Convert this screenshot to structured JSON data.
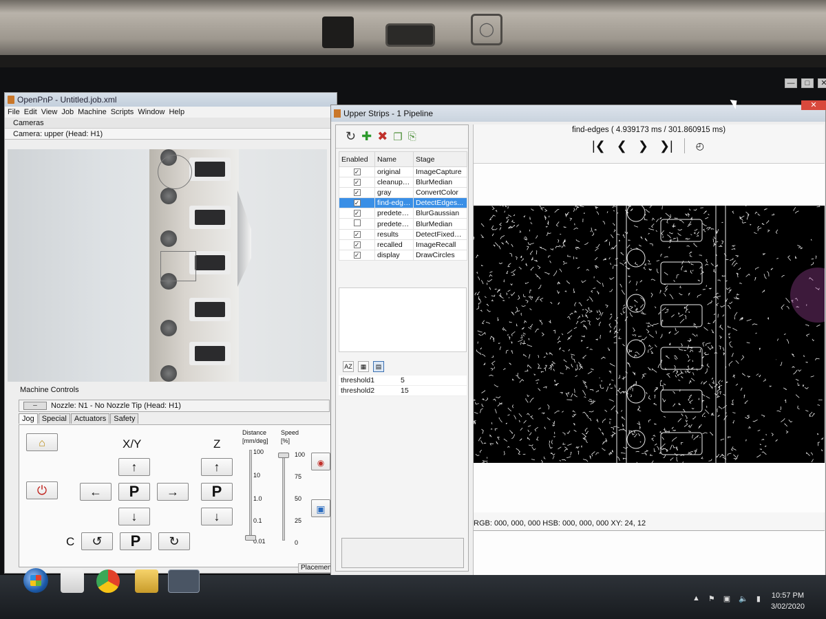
{
  "main_window": {
    "title": "OpenPnP - Untitled.job.xml",
    "menu": [
      "File",
      "Edit",
      "View",
      "Job",
      "Machine",
      "Scripts",
      "Window",
      "Help"
    ],
    "cameras_label": "Cameras",
    "camera_label": "Camera: upper (Head: H1)",
    "machine_controls_label": "Machine Controls",
    "nozzle_label": "Nozzle: N1 - No Nozzle Tip (Head: H1)",
    "tabs": [
      "Jog",
      "Special",
      "Actuators",
      "Safety"
    ],
    "jog": {
      "xy_label": "X/Y",
      "z_label": "Z",
      "c_label": "C",
      "park_label": "P",
      "distance_label": "Distance",
      "distance_unit": "[mm/deg]",
      "speed_label": "Speed",
      "speed_unit": "[%]",
      "distance_ticks": [
        "100",
        "10",
        "1.0",
        "0.1",
        "0.01"
      ],
      "speed_ticks": [
        "100",
        "75",
        "50",
        "25",
        "0"
      ],
      "speed_percent": 100,
      "distance_value": "0.01"
    },
    "status_tab": "Placements"
  },
  "pipeline_window": {
    "title": "Upper Strips - 1 Pipeline",
    "columns": [
      "Enabled",
      "Name",
      "Stage"
    ],
    "stages": [
      {
        "enabled": true,
        "name": "original",
        "stage": "ImageCapture"
      },
      {
        "enabled": true,
        "name": "cleanup-...",
        "stage": "BlurMedian"
      },
      {
        "enabled": true,
        "name": "gray",
        "stage": "ConvertColor"
      },
      {
        "enabled": true,
        "name": "find-edges",
        "stage": "DetectEdges...",
        "selected": true
      },
      {
        "enabled": true,
        "name": "predetec...",
        "stage": "BlurGaussian"
      },
      {
        "enabled": false,
        "name": "predetec...",
        "stage": "BlurMedian"
      },
      {
        "enabled": true,
        "name": "results",
        "stage": "DetectFixedCi..."
      },
      {
        "enabled": true,
        "name": "recalled",
        "stage": "ImageRecall"
      },
      {
        "enabled": true,
        "name": "display",
        "stage": "DrawCircles"
      }
    ],
    "properties": [
      {
        "key": "threshold1",
        "value": "5"
      },
      {
        "key": "threshold2",
        "value": "15"
      }
    ],
    "stage_header": "find-edges ( 4.939173 ms / 301.860915 ms)",
    "readout": "RGB: 000, 000, 000 HSB: 000, 000, 000 XY: 24, 12"
  },
  "taskbar": {
    "time": "10:57 PM",
    "date": "3/02/2020"
  },
  "colors": {
    "selection": "#3a8fe6",
    "power_red": "#c0201a",
    "add_green": "#2c9a2c",
    "delete_red": "#c0302a"
  }
}
